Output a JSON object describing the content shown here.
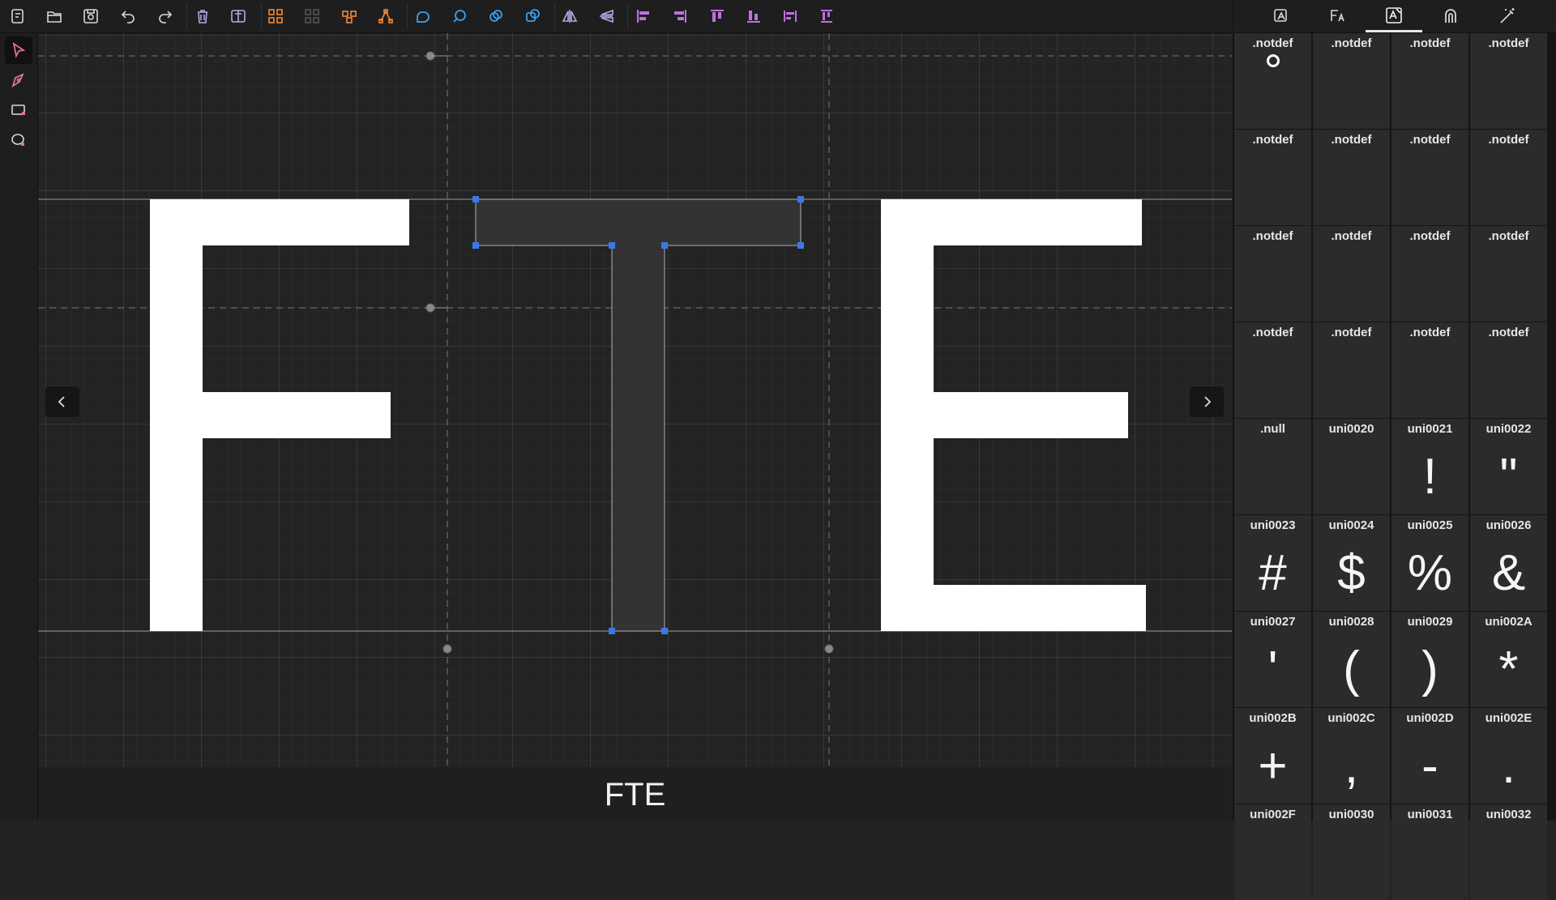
{
  "toolbar": {
    "icons": [
      "new-file-icon",
      "open-folder-icon",
      "save-icon",
      "undo-icon",
      "redo-icon",
      "delete-icon",
      "frame-icon",
      "group-icon",
      "ungroup-icon",
      "arrange-icon",
      "path-points-icon",
      "shape-union-icon",
      "shape-subtract-icon",
      "shape-intersect-icon",
      "shape-exclude-icon",
      "flip-horizontal-icon",
      "flip-vertical-icon",
      "align-left-icon",
      "align-right-icon",
      "align-top-icon",
      "align-bottom-icon",
      "distribute-horizontal-icon",
      "distribute-vertical-icon"
    ]
  },
  "tools": [
    "select-tool",
    "pen-tool",
    "rectangle-tool",
    "ellipse-tool"
  ],
  "right_tabs": [
    "glyph-info-tab",
    "font-settings-tab",
    "glyphs-tab",
    "kerning-tab",
    "magic-tab"
  ],
  "preview": {
    "text": "FTE"
  },
  "glyphs": [
    {
      "label": ".notdef",
      "glyph": "",
      "mark": true
    },
    {
      "label": ".notdef",
      "glyph": ""
    },
    {
      "label": ".notdef",
      "glyph": ""
    },
    {
      "label": ".notdef",
      "glyph": ""
    },
    {
      "label": ".notdef",
      "glyph": ""
    },
    {
      "label": ".notdef",
      "glyph": ""
    },
    {
      "label": ".notdef",
      "glyph": ""
    },
    {
      "label": ".notdef",
      "glyph": ""
    },
    {
      "label": ".notdef",
      "glyph": ""
    },
    {
      "label": ".notdef",
      "glyph": ""
    },
    {
      "label": ".notdef",
      "glyph": ""
    },
    {
      "label": ".notdef",
      "glyph": ""
    },
    {
      "label": ".notdef",
      "glyph": ""
    },
    {
      "label": ".notdef",
      "glyph": ""
    },
    {
      "label": ".notdef",
      "glyph": ""
    },
    {
      "label": ".notdef",
      "glyph": ""
    },
    {
      "label": ".null",
      "glyph": ""
    },
    {
      "label": "uni0020",
      "glyph": ""
    },
    {
      "label": "uni0021",
      "glyph": "!"
    },
    {
      "label": "uni0022",
      "glyph": "\""
    },
    {
      "label": "uni0023",
      "glyph": "#"
    },
    {
      "label": "uni0024",
      "glyph": "$"
    },
    {
      "label": "uni0025",
      "glyph": "%"
    },
    {
      "label": "uni0026",
      "glyph": "&"
    },
    {
      "label": "uni0027",
      "glyph": "'"
    },
    {
      "label": "uni0028",
      "glyph": "("
    },
    {
      "label": "uni0029",
      "glyph": ")"
    },
    {
      "label": "uni002A",
      "glyph": "*"
    },
    {
      "label": "uni002B",
      "glyph": "+"
    },
    {
      "label": "uni002C",
      "glyph": ","
    },
    {
      "label": "uni002D",
      "glyph": "-"
    },
    {
      "label": "uni002E",
      "glyph": "."
    },
    {
      "label": "uni002F",
      "glyph": ""
    },
    {
      "label": "uni0030",
      "glyph": ""
    },
    {
      "label": "uni0031",
      "glyph": ""
    },
    {
      "label": "uni0032",
      "glyph": ""
    }
  ]
}
